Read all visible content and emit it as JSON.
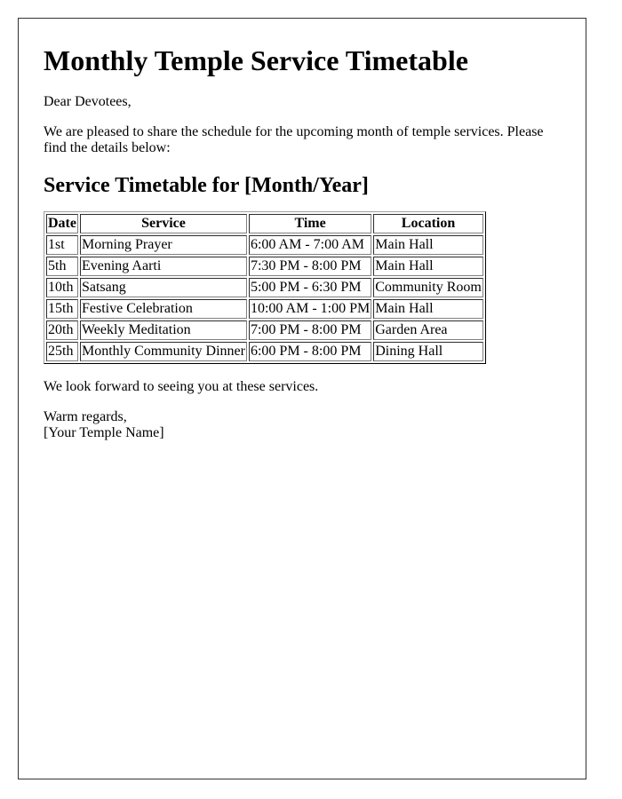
{
  "document": {
    "title": "Monthly Temple Service Timetable",
    "greeting": "Dear Devotees,",
    "intro": "We are pleased to share the schedule for the upcoming month of temple services. Please find the details below:",
    "section_heading": "Service Timetable for [Month/Year]",
    "table": {
      "headers": [
        "Date",
        "Service",
        "Time",
        "Location"
      ],
      "rows": [
        [
          "1st",
          "Morning Prayer",
          "6:00 AM - 7:00 AM",
          "Main Hall"
        ],
        [
          "5th",
          "Evening Aarti",
          "7:30 PM - 8:00 PM",
          "Main Hall"
        ],
        [
          "10th",
          "Satsang",
          "5:00 PM - 6:30 PM",
          "Community Room"
        ],
        [
          "15th",
          "Festive Celebration",
          "10:00 AM - 1:00 PM",
          "Main Hall"
        ],
        [
          "20th",
          "Weekly Meditation",
          "7:00 PM - 8:00 PM",
          "Garden Area"
        ],
        [
          "25th",
          "Monthly Community Dinner",
          "6:00 PM - 8:00 PM",
          "Dining Hall"
        ]
      ]
    },
    "closing": "We look forward to seeing you at these services.",
    "signoff_line1": "Warm regards,",
    "signoff_line2": "[Your Temple Name]"
  }
}
